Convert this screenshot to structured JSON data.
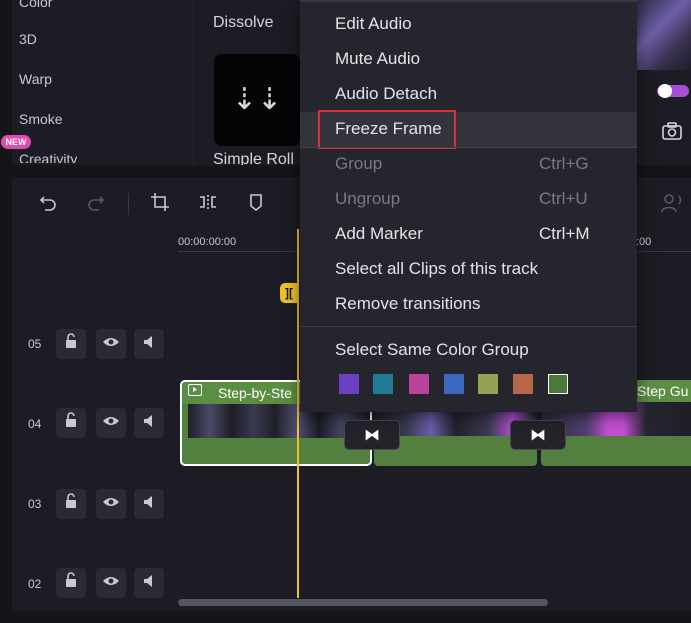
{
  "effects_panel": {
    "categories": [
      "Color",
      "3D",
      "Warp",
      "Smoke",
      "Creativity"
    ],
    "new_badge": "NEW",
    "transition_name": "Dissolve",
    "transition_thumb_glyph": "⇣⇣",
    "next_transition": "Simple Roll"
  },
  "timeline": {
    "ruler_start": "00:00:00:00",
    "ruler_end_partial": ":00",
    "playhead_marker_glyph": "][",
    "tracks": [
      {
        "label": "05"
      },
      {
        "label": "04"
      },
      {
        "label": "03"
      },
      {
        "label": "02"
      }
    ],
    "clip_main_title": "Step-by-Ste",
    "clip_right_title": "Step Gu",
    "transition_glyph": "⧓"
  },
  "context_menu": {
    "items": [
      {
        "label": "Edit Audio",
        "shortcut": "",
        "enabled": true
      },
      {
        "label": "Mute Audio",
        "shortcut": "",
        "enabled": true
      },
      {
        "label": "Audio Detach",
        "shortcut": "",
        "enabled": true
      },
      {
        "label": "Freeze Frame",
        "shortcut": "",
        "enabled": true,
        "highlighted": true
      },
      {
        "label": "Group",
        "shortcut": "Ctrl+G",
        "enabled": false
      },
      {
        "label": "Ungroup",
        "shortcut": "Ctrl+U",
        "enabled": false
      },
      {
        "label": "Add Marker",
        "shortcut": "Ctrl+M",
        "enabled": true
      },
      {
        "label": "Select all Clips of this track",
        "shortcut": "",
        "enabled": true
      },
      {
        "label": "Remove transitions",
        "shortcut": "",
        "enabled": true
      },
      {
        "label": "Select Same Color Group",
        "shortcut": "",
        "enabled": true
      }
    ],
    "color_swatches": [
      "#6d3fc4",
      "#1f7a93",
      "#b8449c",
      "#3a68bd",
      "#97a154",
      "#b4674b",
      "#4a7a3a"
    ]
  },
  "colors": {
    "accent_playhead": "#f0c02a",
    "highlight_border": "#d8323c",
    "clip_green": "#53803e",
    "toggle_purple": "#a64ed8"
  }
}
